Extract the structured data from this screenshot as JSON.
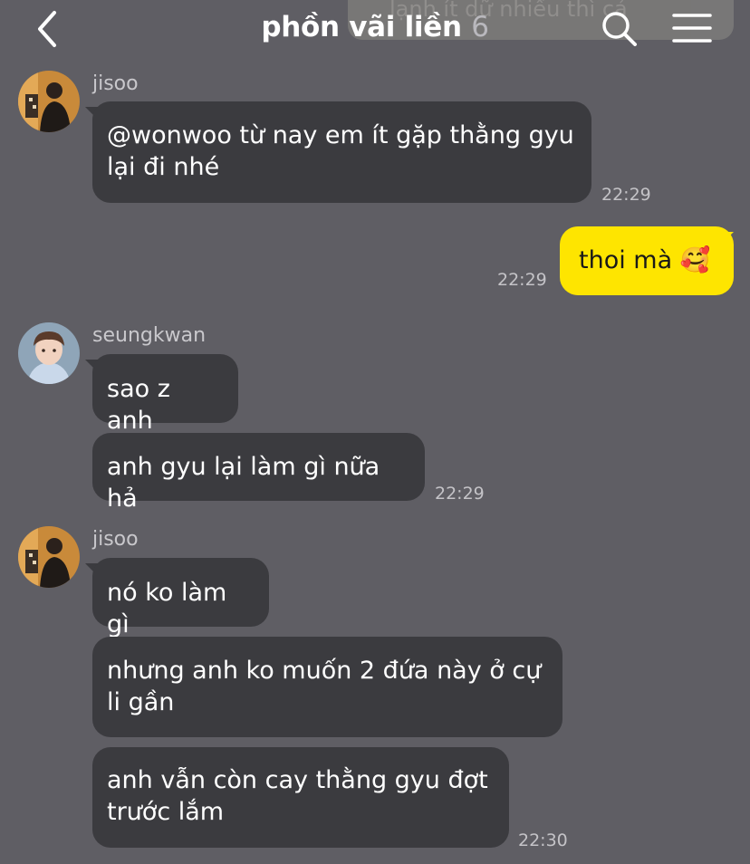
{
  "header": {
    "title": "phồn vãi liền",
    "member_count": "6",
    "notice_preview": "lạnh ít dữ nhiều thì cả"
  },
  "messages": [
    {
      "sender": "jisoo",
      "text": "@wonwoo từ nay em ít gặp thằng gyu\nlại đi nhé",
      "time": "22:29"
    },
    {
      "sender": "me",
      "text": "thoi mà 🥰",
      "time": "22:29"
    },
    {
      "sender": "seungkwan",
      "text": "sao z anh"
    },
    {
      "sender": "seungkwan",
      "text": "anh gyu lại làm gì nữa hả",
      "time": "22:29"
    },
    {
      "sender": "jisoo",
      "text": "nó ko làm gì"
    },
    {
      "sender": "jisoo",
      "text": "nhưng anh ko muốn 2 đứa này ở cự\nli gần"
    },
    {
      "sender": "jisoo",
      "text": "anh vẫn còn cay thằng gyu đợt\ntrước lắm",
      "time": "22:30"
    }
  ],
  "colors": {
    "background": "#5f5e64",
    "bubble_other": "#3b3b3f",
    "bubble_mine": "#fee500"
  }
}
